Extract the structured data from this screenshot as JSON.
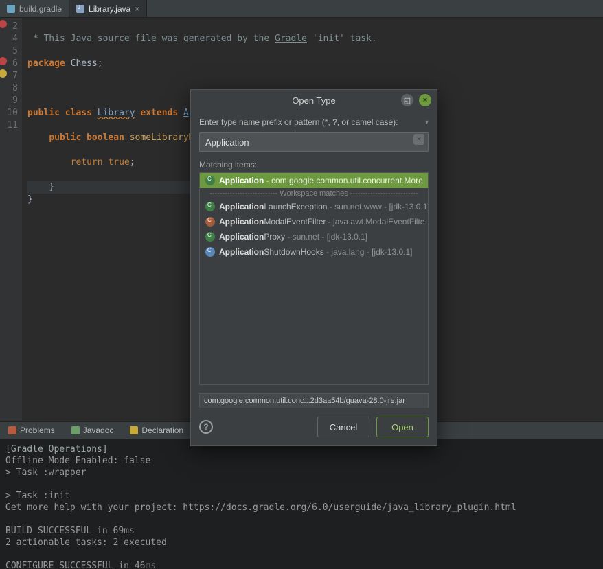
{
  "tabs": {
    "list": [
      {
        "label": "build.gradle",
        "active": false
      },
      {
        "label": "Library.java",
        "active": true
      }
    ]
  },
  "code": {
    "lines": [
      "2",
      "4",
      "5",
      "6",
      "7",
      "8",
      "9",
      "10",
      "11"
    ],
    "l2": " * This Java source file was generated by the Gradle 'init' task.",
    "l4_kw": "package",
    "l4_rest": " Chess;",
    "l6_kw1": "public",
    "l6_kw2": "class",
    "l6_name": "Library",
    "l6_ext": "extends",
    "l6_app": "Application",
    "l6_brace": " {",
    "l7_kw1": "public",
    "l7_kw2": "boolean",
    "l7_method": "someLibraryMethod",
    "l7_rest": "() {",
    "l8_kw": "return",
    "l8_val": "true",
    "l8_semi": ";",
    "l9": "    }",
    "l10": "}",
    "underlined_word": "Gradle"
  },
  "panel_tabs": {
    "problems": "Problems",
    "javadoc": "Javadoc",
    "declaration": "Declaration"
  },
  "console": {
    "header": "[Gradle Operations]",
    "lines": [
      "Offline Mode Enabled: false",
      "> Task :wrapper",
      "",
      "> Task :init",
      "Get more help with your project: https://docs.gradle.org/6.0/userguide/java_library_plugin.html",
      "",
      "BUILD SUCCESSFUL in 69ms",
      "2 actionable tasks: 2 executed",
      "",
      "CONFIGURE SUCCESSFUL in 46ms"
    ]
  },
  "dialog": {
    "title": "Open Type",
    "prompt": "Enter type name prefix or pattern (*, ?, or camel case):",
    "input_value": "Application",
    "matching_label": "Matching items:",
    "workspace_divider": "--------------------------- Workspace matches ---------------------------",
    "results": [
      {
        "bold": "Application",
        "rest": "",
        "muted": " - com.google.common.util.concurrent.More",
        "selected": true
      },
      {
        "bold": "Application",
        "rest": "LaunchException",
        "muted": " - sun.net.www - [jdk-13.0.1]",
        "selected": false
      },
      {
        "bold": "Application",
        "rest": "ModalEventFilter",
        "muted": " - java.awt.ModalEventFilte",
        "selected": false,
        "warn": true
      },
      {
        "bold": "Application",
        "rest": "Proxy",
        "muted": " - sun.net - [jdk-13.0.1]",
        "selected": false
      },
      {
        "bold": "Application",
        "rest": "ShutdownHooks",
        "muted": " - java.lang - [jdk-13.0.1]",
        "selected": false,
        "lib": true
      }
    ],
    "status": "com.google.common.util.conc...2d3aa54b/guava-28.0-jre.jar",
    "cancel": "Cancel",
    "open": "Open"
  }
}
